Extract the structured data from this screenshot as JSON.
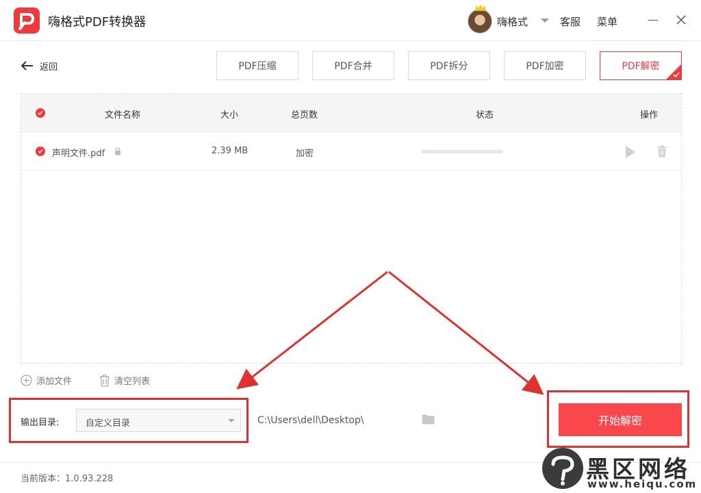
{
  "app": {
    "title": "嗨格式PDF转换器",
    "brand_color": "#f0393d"
  },
  "header": {
    "username": "嗨格式",
    "service_label": "客服",
    "menu_label": "菜单"
  },
  "toolbar": {
    "back_label": "返回",
    "tabs": [
      {
        "label": "PDF压缩",
        "active": false
      },
      {
        "label": "PDF合并",
        "active": false
      },
      {
        "label": "PDF拆分",
        "active": false
      },
      {
        "label": "PDF加密",
        "active": false
      },
      {
        "label": "PDF解密",
        "active": true
      }
    ]
  },
  "file_list": {
    "columns": [
      "文件名称",
      "大小",
      "总页数",
      "状态",
      "操作"
    ],
    "rows": [
      {
        "name": "声明文件.pdf",
        "size": "2.39 MB",
        "pages": "加密",
        "progress": 0
      }
    ]
  },
  "actions": {
    "add_file": "添加文件",
    "clear_list": "清空列表"
  },
  "output": {
    "label": "输出目录:",
    "selected": "自定义目录",
    "path": "C:\\Users\\dell\\Desktop\\"
  },
  "start_button": "开始解密",
  "footer": {
    "version": "当前版本：1.0.93.228"
  },
  "watermark": {
    "title": "黑区网络",
    "url": "www.heiqu.com"
  },
  "icons": [
    "logo-icon",
    "back-arrow-icon",
    "lock-icon",
    "play-icon",
    "trash-icon",
    "plus-circle-icon",
    "folder-icon",
    "close-icon",
    "minimize-icon",
    "chevron-down-icon"
  ]
}
